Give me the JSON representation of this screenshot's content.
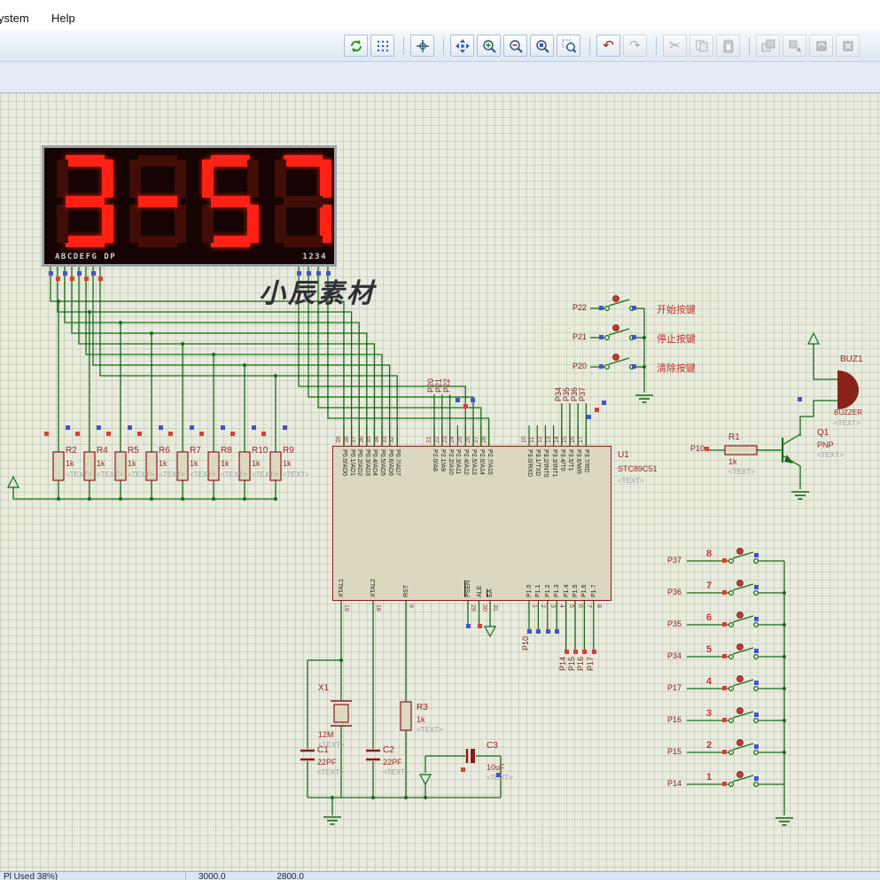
{
  "menu": {
    "items": [
      "ystem",
      "Help"
    ]
  },
  "toolbar": {
    "icons": [
      "redraw",
      "toggle-grid",
      "origin",
      "pan",
      "zoom-in",
      "zoom-out",
      "zoom-extents",
      "zoom-area",
      "undo",
      "redo",
      "cut",
      "copy",
      "paste",
      "block-copy",
      "block-move",
      "block-rotate",
      "block-delete"
    ]
  },
  "statusbar": {
    "left": "Pl Used 38%)",
    "coord_x": "3000.0",
    "coord_y": "2800.0"
  },
  "canvas": {
    "watermark": "小辰素材",
    "display": {
      "value": "3-57",
      "segments_label": "ABCDEFG DP",
      "digits_label": "1234"
    },
    "resistors": [
      {
        "ref": "R2",
        "value": "1k",
        "text": "<TEXT>"
      },
      {
        "ref": "R4",
        "value": "1k",
        "text": "<TEXT>"
      },
      {
        "ref": "R5",
        "value": "1k",
        "text": "<TEXT>"
      },
      {
        "ref": "R6",
        "value": "1k",
        "text": "<TEXT>"
      },
      {
        "ref": "R7",
        "value": "1k",
        "text": "<TEXT>"
      },
      {
        "ref": "R8",
        "value": "1k",
        "text": "<TEXT>"
      },
      {
        "ref": "R10",
        "value": "1k",
        "text": "<TEXT>"
      },
      {
        "ref": "R9",
        "value": "1k",
        "text": "<TEXT>"
      }
    ],
    "u1": {
      "ref": "U1",
      "value": "STC89C51",
      "text": "<TEXT>",
      "top_pins": [
        {
          "labels": [
            "P0.0/AD0",
            "P0.1/AD1",
            "P0.2/AD2",
            "P0.3/AD3",
            "P0.4/AD4",
            "P0.5/AD5",
            "P0.6/AD6",
            "P0.7/AD7"
          ],
          "numbers": [
            "39",
            "38",
            "37",
            "36",
            "35",
            "34",
            "33",
            "32"
          ]
        },
        {
          "labels": [
            "P2.0/A8",
            "P2.1/A9",
            "P2.2/A10",
            "P2.3/A11",
            "P2.4/A12",
            "P2.5/A13",
            "P2.6/A14",
            "P2.7/A15"
          ],
          "numbers": [
            "21",
            "22",
            "23",
            "24",
            "25",
            "26",
            "27",
            "28"
          ]
        },
        {
          "labels": [
            "P3.0/RXD",
            "P3.1/TXD",
            "P3.2/INT0",
            "P3.3/INT1",
            "P3.4/T0",
            "P3.5/T1",
            "P3.6/WR",
            "P3.7/RD"
          ],
          "numbers": [
            "10",
            "11",
            "12",
            "13",
            "14",
            "15",
            "16",
            "17"
          ]
        }
      ],
      "bottom_pins": {
        "labels": [
          "XTAL1",
          "XTAL2",
          "RST",
          "PSEN",
          "ALE",
          "EA",
          "P1.0",
          "P1.1",
          "P1.2",
          "P1.3",
          "P1.4",
          "P1.5",
          "P1.6",
          "P1.7"
        ],
        "numbers": [
          "19",
          "18",
          "9",
          "29",
          "30",
          "31",
          "1",
          "2",
          "3",
          "4",
          "5",
          "6",
          "7",
          "8"
        ]
      },
      "top_net_labels": [
        "P20",
        "P21",
        "P22",
        "P34",
        "P35",
        "P36",
        "P37"
      ],
      "bottom_net_labels": [
        "P10",
        "P14",
        "P15",
        "P16",
        "P17"
      ]
    },
    "crystal": {
      "ref": "X1",
      "value": "12M",
      "text": "<TEXT>"
    },
    "c1": {
      "ref": "C1",
      "value": "22PF",
      "text": "<TEXT>"
    },
    "c2": {
      "ref": "C2",
      "value": "22PF",
      "text": "<TEXT>"
    },
    "c3": {
      "ref": "C3",
      "value": "10uF",
      "text": "<TEXT>"
    },
    "r3": {
      "ref": "R3",
      "value": "1k",
      "text": "<TEXT>"
    },
    "r1": {
      "ref": "R1",
      "value": "1k",
      "text": "<TEXT>",
      "net": "P10"
    },
    "transistor": {
      "ref": "Q1",
      "value": "PNP",
      "text": "<TEXT>"
    },
    "buzzer": {
      "ref": "BUZ1",
      "value": "BUZZER",
      "text": "<TEXT>"
    },
    "control_buttons": [
      {
        "net": "P22",
        "label": "开始按键"
      },
      {
        "net": "P21",
        "label": "停止按键"
      },
      {
        "net": "P20",
        "label": "清除按键"
      }
    ],
    "key_buttons": [
      {
        "net": "P37",
        "num": "8"
      },
      {
        "net": "P36",
        "num": "7"
      },
      {
        "net": "P35",
        "num": "6"
      },
      {
        "net": "P34",
        "num": "5"
      },
      {
        "net": "P17",
        "num": "4"
      },
      {
        "net": "P16",
        "num": "3"
      },
      {
        "net": "P15",
        "num": "2"
      },
      {
        "net": "P14",
        "num": "1"
      }
    ]
  }
}
